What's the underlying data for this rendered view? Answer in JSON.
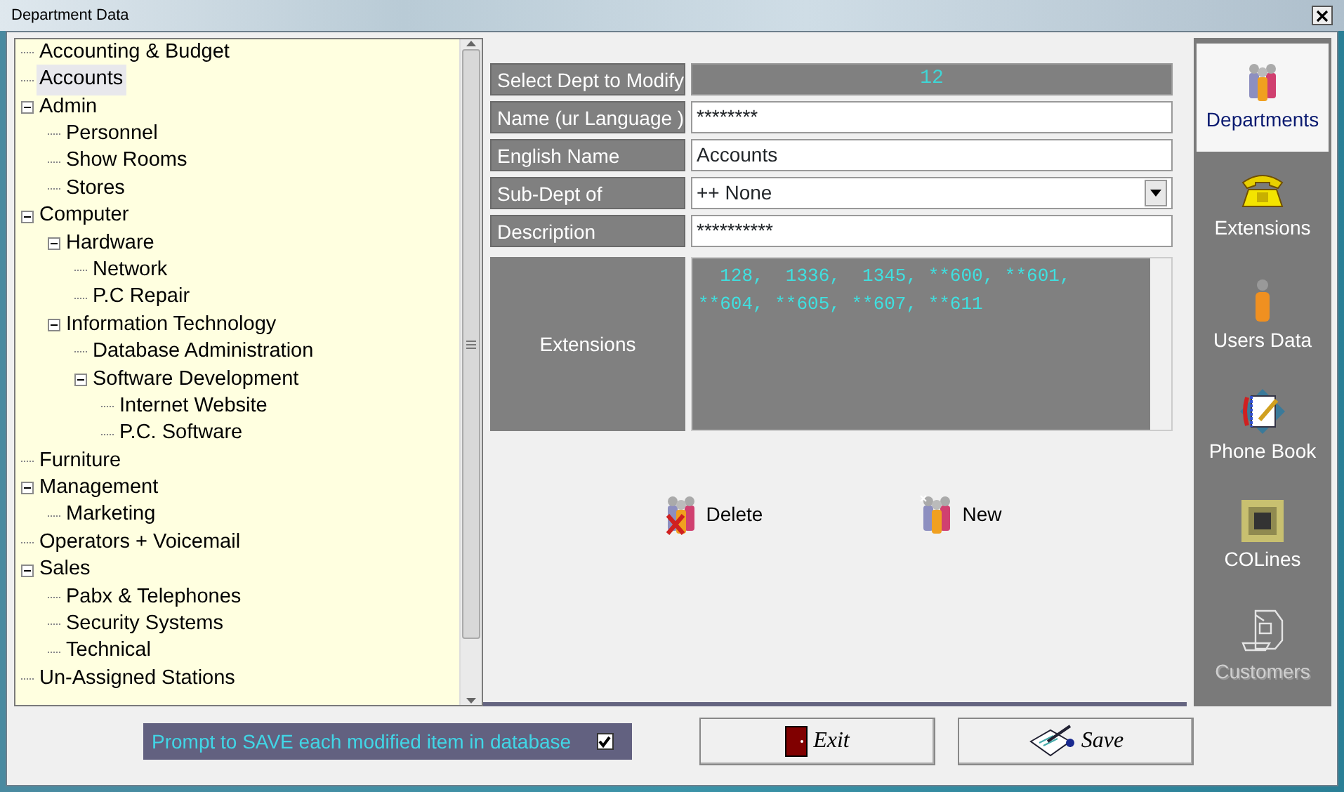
{
  "window": {
    "title": "Department Data"
  },
  "tree": [
    {
      "label": "Accounting & Budget",
      "selected": false
    },
    {
      "label": "Accounts",
      "selected": true
    },
    {
      "label": "Admin",
      "selected": false,
      "expanded": true,
      "children": [
        {
          "label": "Personnel",
          "selected": false
        },
        {
          "label": "Show Rooms",
          "selected": false
        },
        {
          "label": "Stores",
          "selected": false
        }
      ]
    },
    {
      "label": "Computer",
      "selected": false,
      "expanded": true,
      "children": [
        {
          "label": "Hardware",
          "selected": false,
          "expanded": true,
          "children": [
            {
              "label": "Network",
              "selected": false
            },
            {
              "label": "P.C Repair",
              "selected": false
            }
          ]
        },
        {
          "label": "Information Technology",
          "selected": false,
          "expanded": true,
          "children": [
            {
              "label": "Database Administration",
              "selected": false
            },
            {
              "label": "Software Development",
              "selected": false,
              "expanded": true,
              "children": [
                {
                  "label": "Internet Website",
                  "selected": false
                },
                {
                  "label": "P.C. Software",
                  "selected": false
                }
              ]
            }
          ]
        }
      ]
    },
    {
      "label": "Furniture",
      "selected": false
    },
    {
      "label": "Management",
      "selected": false,
      "expanded": true,
      "children": [
        {
          "label": "Marketing",
          "selected": false
        }
      ]
    },
    {
      "label": "Operators + Voicemail",
      "selected": false
    },
    {
      "label": "Sales",
      "selected": false,
      "expanded": true,
      "children": [
        {
          "label": "Pabx & Telephones",
          "selected": false
        },
        {
          "label": "Security Systems",
          "selected": false
        },
        {
          "label": "Technical",
          "selected": false
        }
      ]
    },
    {
      "label": "Un-Assigned Stations",
      "selected": false
    }
  ],
  "form": [
    {
      "kind": "readout",
      "label": "Select Dept to Modify",
      "value": "12"
    },
    {
      "kind": "text",
      "label": "Name (ur Language )",
      "value": "********"
    },
    {
      "kind": "text",
      "label": "English Name",
      "value": "Accounts"
    },
    {
      "kind": "select",
      "label": "Sub-Dept of",
      "value": "++ None"
    },
    {
      "kind": "text",
      "label": "Description",
      "value": "**********"
    }
  ],
  "extensions": {
    "label": "Extensions",
    "value": "  128,  1336,  1345, **600, **601,\n**604, **605, **607, **611"
  },
  "actions": [
    {
      "kind": "delete",
      "label": "Delete"
    },
    {
      "kind": "new",
      "label": "New"
    }
  ],
  "nav": [
    {
      "kind": "departments",
      "label": "Departments",
      "selected": true,
      "disabled": false
    },
    {
      "kind": "extensions",
      "label": "Extensions",
      "selected": false,
      "disabled": false
    },
    {
      "kind": "users",
      "label": "Users Data",
      "selected": false,
      "disabled": false
    },
    {
      "kind": "phonebook",
      "label": "Phone Book",
      "selected": false,
      "disabled": false
    },
    {
      "kind": "colines",
      "label": "COLines",
      "selected": false,
      "disabled": false
    },
    {
      "kind": "customers",
      "label": "Customers",
      "selected": false,
      "disabled": true
    }
  ],
  "prompt": {
    "label": "Prompt to SAVE each modified item in database",
    "checked": true
  },
  "buttons": [
    {
      "kind": "exit",
      "label": "Exit"
    },
    {
      "kind": "save",
      "label": "Save"
    }
  ]
}
